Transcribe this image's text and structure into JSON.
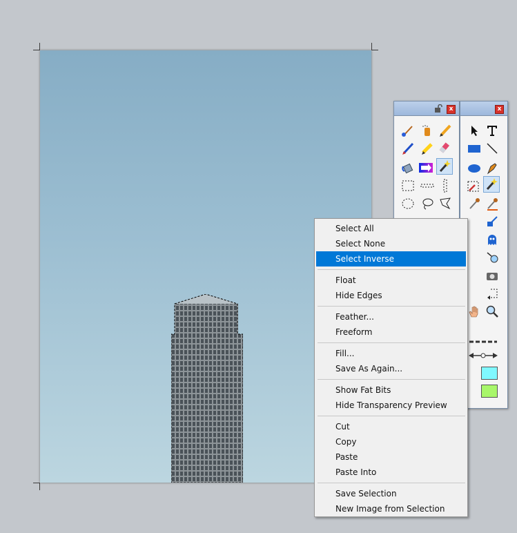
{
  "context_menu": {
    "groups": [
      [
        "Select All",
        "Select None",
        "Select Inverse"
      ],
      [
        "Float",
        "Hide Edges"
      ],
      [
        "Feather...",
        "Freeform"
      ],
      [
        "Fill...",
        "Save As Again..."
      ],
      [
        "Show Fat Bits",
        "Hide Transparency Preview"
      ],
      [
        "Cut",
        "Copy",
        "Paste",
        "Paste Into"
      ],
      [
        "Save Selection",
        "New Image from Selection"
      ]
    ],
    "highlighted": "Select Inverse"
  },
  "palettes": {
    "left_close": "x",
    "right_close": "x"
  },
  "colors": {
    "highlight": "#0078d7",
    "fill_swatch": "#7ff8ff",
    "stroke_swatch": "#a8f76a"
  },
  "icons": [
    "lock-icon",
    "brush-icon",
    "spray-can-icon",
    "pencil-icon",
    "paint-brush-icon",
    "highlighter-icon",
    "eraser-icon",
    "paint-bucket-icon",
    "gradient-icon",
    "magic-wand-icon",
    "rect-marquee-icon",
    "row-marquee-icon",
    "column-marquee-icon",
    "ellipse-marquee-icon",
    "lasso-icon",
    "polygon-lasso-icon",
    "pointer-icon",
    "text-icon",
    "rectangle-icon",
    "line-icon",
    "ellipse-icon",
    "pen-icon",
    "eyedropper-icon",
    "zoom-icon",
    "hand-icon"
  ]
}
